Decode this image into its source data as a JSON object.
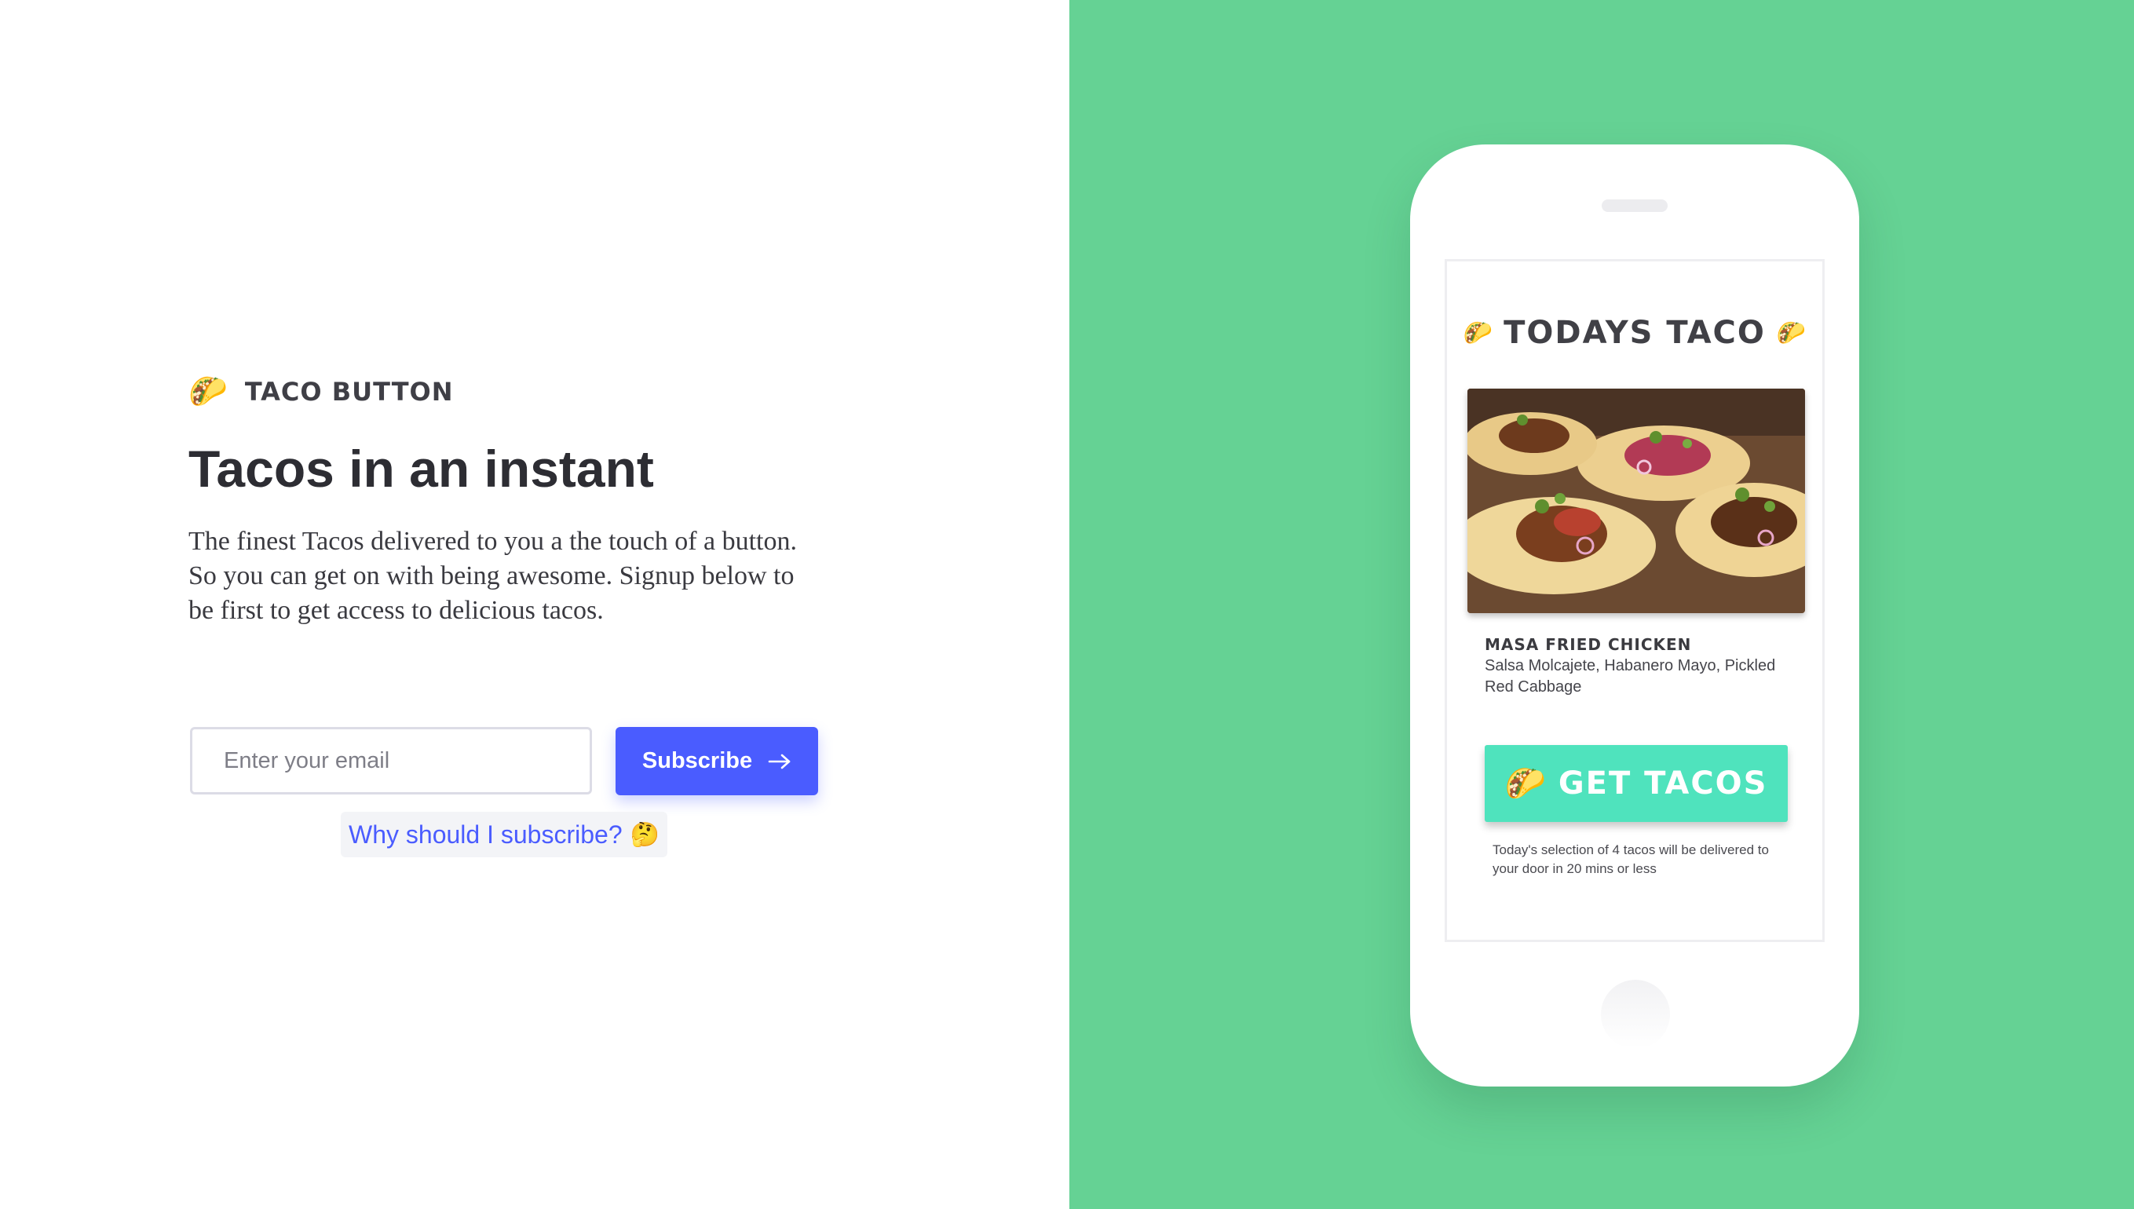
{
  "brand": {
    "emoji": "🌮",
    "name": "TACO BUTTON"
  },
  "hero": {
    "headline": "Tacos in an instant",
    "intro": "The finest Tacos delivered to you a the touch of a button. So you can get on with being awesome. Signup below to be first to get access to delicious tacos."
  },
  "signup": {
    "email_placeholder": "Enter your email",
    "email_value": "",
    "subscribe_label": "Subscribe",
    "subscribe_icon": "arrow-right-icon",
    "why_link": "Why should I subscribe?",
    "why_emoji": "🤔"
  },
  "app": {
    "title": "TODAYS TACO",
    "title_emoji": "🌮",
    "photo_icon": "taco-photo",
    "dish_name": "MASA FRIED CHICKEN",
    "dish_description": "Salsa Molcajete, Habanero Mayo, Pickled Red Cabbage",
    "cta_emoji": "🌮",
    "cta_label": "GET TACOS",
    "delivery_note": "Today's selection of 4 tacos will be delivered to your door in 20 mins or less"
  },
  "colors": {
    "accent": "#4a5cff",
    "right_background": "#65d294",
    "cta_background": "#4fe3bd",
    "text_dark": "#2d2d33"
  }
}
